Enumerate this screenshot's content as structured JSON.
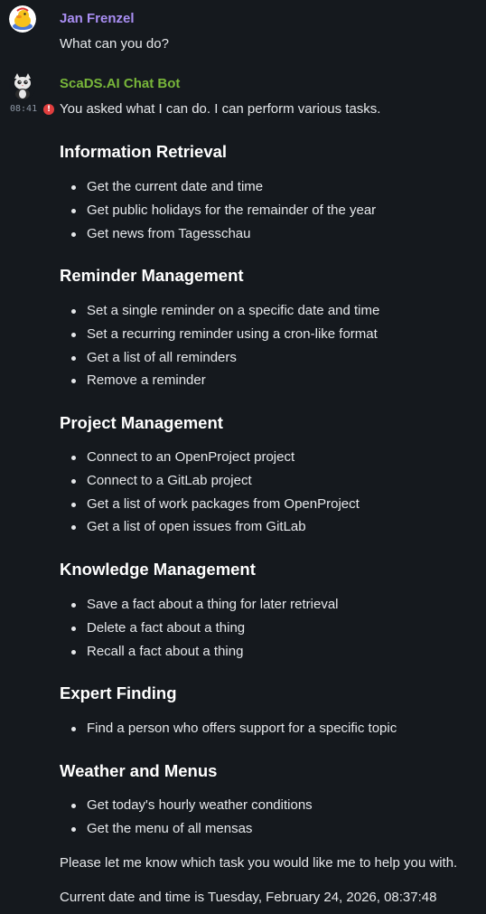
{
  "messages": [
    {
      "sender": "Jan Frenzel",
      "sender_color": "#a98ef3",
      "avatar_icon": "duck-avatar-icon",
      "text": "What can you do?"
    },
    {
      "sender": "ScaDS.AI Chat Bot",
      "sender_color": "#78b63a",
      "avatar_icon": "cat-avatar-icon",
      "timestamp": "08:41",
      "status_icon": "warning-icon",
      "status_color": "#e03e3e",
      "intro": "You asked what I can do. I can perform various tasks.",
      "sections": [
        {
          "title": "Information Retrieval",
          "items": [
            "Get the current date and time",
            "Get public holidays for the remainder of the year",
            "Get news from Tagesschau"
          ]
        },
        {
          "title": "Reminder Management",
          "items": [
            "Set a single reminder on a specific date and time",
            "Set a recurring reminder using a cron-like format",
            "Get a list of all reminders",
            "Remove a reminder"
          ]
        },
        {
          "title": "Project Management",
          "items": [
            "Connect to an OpenProject project",
            "Connect to a GitLab project",
            "Get a list of work packages from OpenProject",
            "Get a list of open issues from GitLab"
          ]
        },
        {
          "title": "Knowledge Management",
          "items": [
            "Save a fact about a thing for later retrieval",
            "Delete a fact about a thing",
            "Recall a fact about a thing"
          ]
        },
        {
          "title": "Expert Finding",
          "items": [
            "Find a person who offers support for a specific topic"
          ]
        },
        {
          "title": "Weather and Menus",
          "items": [
            "Get today's hourly weather conditions",
            "Get the menu of all mensas"
          ]
        }
      ],
      "closing": "Please let me know which task you would like me to help you with.",
      "datetime_line": "Current date and time is Tuesday, February 24, 2026, 08:37:48"
    }
  ]
}
